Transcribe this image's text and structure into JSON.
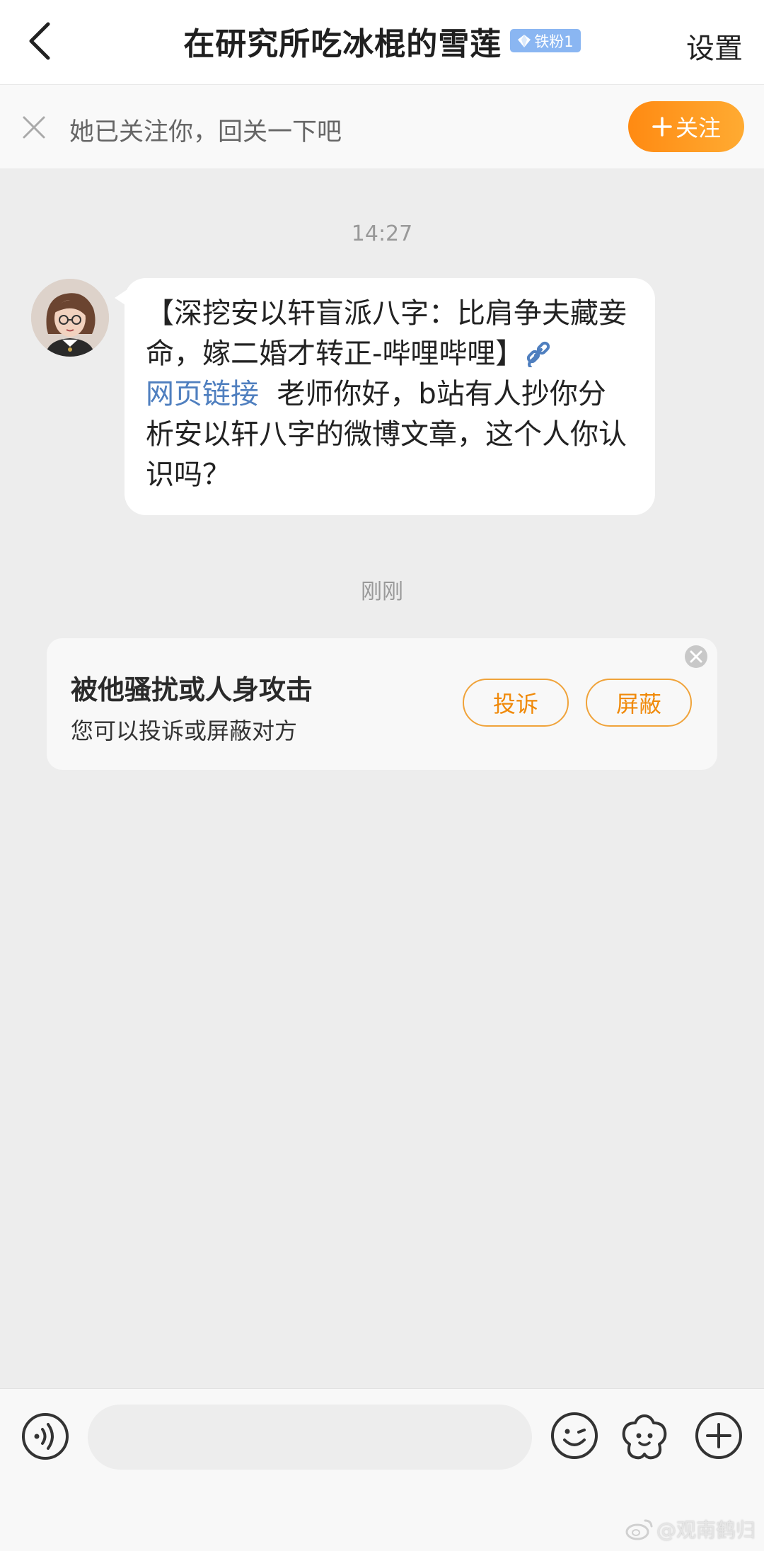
{
  "header": {
    "title": "在研究所吃冰棍的雪莲",
    "badge": "铁粉1",
    "settings_label": "设置"
  },
  "follow_bar": {
    "text": "她已关注你，回关一下吧",
    "follow_button": "关注"
  },
  "conversation": {
    "timestamp_1": "14:27",
    "message": {
      "part1": "【深挖安以轩盲派八字：比肩争夫藏妾命，嫁二婚才转正-哔哩哔哩】",
      "link_label": "网页链接",
      "part2": "  老师你好，b站有人抄你分析安以轩八字的微博文章，这个人你认识吗？"
    },
    "timestamp_2": "刚刚"
  },
  "report_card": {
    "title": "被他骚扰或人身攻击",
    "subtitle": "您可以投诉或屏蔽对方",
    "complain_label": "投诉",
    "block_label": "屏蔽"
  },
  "input_bar": {
    "placeholder": ""
  },
  "watermark": {
    "text": "@观南鹤归"
  },
  "colors": {
    "accent_orange": "#ff9a1f",
    "link_blue": "#4f7fbf",
    "badge_blue": "#8ab6f2",
    "chat_background": "#ededed"
  }
}
